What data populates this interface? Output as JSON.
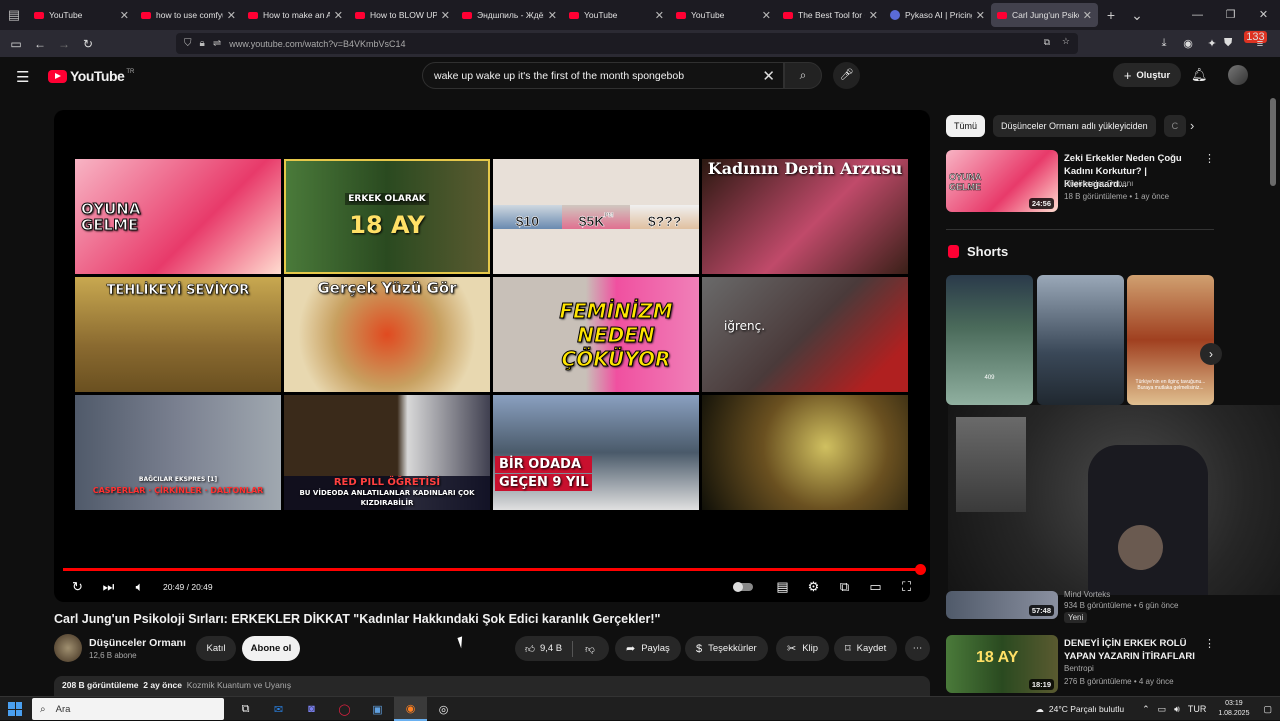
{
  "browser": {
    "tabs": [
      {
        "title": "YouTube",
        "icon": "youtube-favicon"
      },
      {
        "title": "how to use comfyu",
        "icon": "youtube-favicon"
      },
      {
        "title": "How to make an AI",
        "icon": "youtube-favicon"
      },
      {
        "title": "How to BLOW UP y",
        "icon": "youtube-favicon"
      },
      {
        "title": "Эндшпиль - Ждёш",
        "icon": "youtube-favicon"
      },
      {
        "title": "YouTube",
        "icon": "youtube-favicon"
      },
      {
        "title": "YouTube",
        "icon": "youtube-favicon"
      },
      {
        "title": "The Best Tool for Gr",
        "icon": "youtube-favicon"
      },
      {
        "title": "Pykaso AI | Pricing",
        "icon": "pykaso-favicon"
      },
      {
        "title": "Carl Jung'un Psikolo",
        "icon": "youtube-favicon"
      }
    ],
    "url": "www.youtube.com/watch?v=B4VKmbVsC14",
    "extension_badge": "133"
  },
  "youtube": {
    "logo_text": "YouTube",
    "logo_country": "TR",
    "search_value": "wake up wake up it's the first of the month spongebob",
    "create_label": "Oluştur"
  },
  "player": {
    "time": "20:49 / 20:49",
    "progress": 1.0,
    "accent": "#ff0000",
    "end_screen": [
      {
        "text": "OYUNA GELME"
      },
      {
        "text_top": "ERKEK OLARAK",
        "text_big": "18 AY"
      },
      {
        "prices": [
          "$10",
          "$5K",
          "$???"
        ],
        "sub": "PM"
      },
      {
        "text": "Kadının Derin Arzusu"
      },
      {
        "text": "TEHLİKEYİ SEVİYOR"
      },
      {
        "text": "Gerçek Yüzü Gör"
      },
      {
        "text": "FEMİNİZM NEDEN ÇÖKÜYOR"
      },
      {
        "text": "iğrenç."
      },
      {
        "text": "BAĞCILAR EKSPRES [1]",
        "sub": "CASPERLAR · ÇİRKİNLER · DALTONLAR"
      },
      {
        "text_top": "RED PILL ÖĞRETİSİ",
        "sub": "BU VİDEODA ANLATILANLAR KADINLARI ÇOK KIZDIRABİLİR"
      },
      {
        "lines": [
          "BİR ODADA",
          "GEÇEN 9 YIL"
        ]
      },
      {
        "text": ""
      }
    ]
  },
  "video": {
    "title": "Carl Jung'un Psikoloji Sırları: ERKEKLER DİKKAT \"Kadınlar Hakkındaki Şok Edici karanlık Gerçekler!\"",
    "channel": "Düşünceler Ormanı",
    "subscribers": "12,6 B abone",
    "join_label": "Katıl",
    "subscribe_label": "Abone ol",
    "likes": "9,4 B",
    "share_label": "Paylaş",
    "thanks_label": "Teşekkürler",
    "clip_label": "Klip",
    "save_label": "Kaydet",
    "views": "208 B görüntüleme",
    "age": "2 ay önce",
    "tags": "Kozmik Kuantum ve Uyanış"
  },
  "sidebar": {
    "chips": [
      "Tümü",
      "Düşünceler Ormanı adlı yükleyiciden",
      "C"
    ],
    "recommended": [
      {
        "title": "Zeki Erkekler Neden Çoğu Kadını Korkutur? | Kierkegaard...",
        "channel": "Düşünceler Ormanı",
        "meta": "18 B görüntüleme • 1 ay önce",
        "duration": "24:56",
        "thumb_text": "OYUNA GELME"
      }
    ],
    "shorts_title": "Shorts",
    "shorts": [
      {
        "caption": "409"
      },
      {
        "caption": ""
      },
      {
        "caption": "Türkiye'nin en ilginç tavuğunu... Buraya mutlaka gelmelisiniz..."
      }
    ],
    "lower": [
      {
        "channel": "Mind Vorteks",
        "meta": "934 B görüntüleme • 6 gün önce",
        "badge": "Yeni",
        "duration": "57:48"
      },
      {
        "title": "DENEYİ İÇİN ERKEK ROLÜ YAPAN YAZARIN İTİRAFLARI",
        "channel": "Bentropi",
        "meta": "276 B görüntüleme • 4 ay önce",
        "duration": "18:19",
        "thumb_text": "18 AY"
      }
    ]
  },
  "taskbar": {
    "search_placeholder": "Ara",
    "weather": "24°C  Parçalı bulutlu",
    "lang": "TUR",
    "time": "03:19",
    "date": "1.08.2025"
  }
}
